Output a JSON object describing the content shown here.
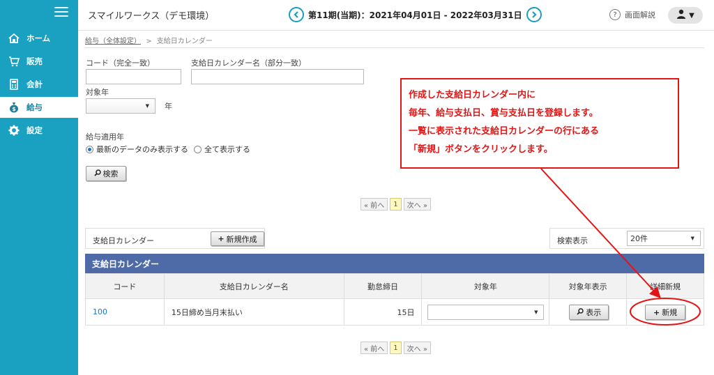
{
  "header": {
    "app_title": "スマイルワークス（デモ環境）",
    "period_text": "第11期(当期)：2021年04月01日 - 2022年03月31日",
    "prev_icon": "chevron-left-icon",
    "next_icon": "chevron-right-icon",
    "help_label": "画面解説",
    "user_icon": "user-icon"
  },
  "sidebar": {
    "items": [
      {
        "label": "ホーム",
        "icon": "home-icon"
      },
      {
        "label": "販売",
        "icon": "cart-icon"
      },
      {
        "label": "会計",
        "icon": "calculator-icon"
      },
      {
        "label": "給与",
        "icon": "money-bag-icon"
      },
      {
        "label": "設定",
        "icon": "gear-icon"
      }
    ],
    "active_index": 3
  },
  "breadcrumb": {
    "parent": "給与（全体設定）",
    "separator": ">",
    "current": "支給日カレンダー"
  },
  "search": {
    "code_label": "コード（完全一致）",
    "code_value": "",
    "name_label": "支給日カレンダー名（部分一致）",
    "name_value": "",
    "year_label": "対象年",
    "year_value": "",
    "year_suffix": "年",
    "apply_year_label": "給与適用年",
    "radio_latest": "最新のデータのみ表示する",
    "radio_all": "全て表示する",
    "radio_selected": "latest",
    "search_button": "検索"
  },
  "pager": {
    "prev": "« 前へ",
    "current": "1",
    "next": "次へ »"
  },
  "list": {
    "calendar_label": "支給日カレンダー",
    "new_button": "新規作成",
    "display_label": "検索表示",
    "display_value": "20件"
  },
  "table": {
    "title": "支給日カレンダー",
    "columns": [
      "コード",
      "支給日カレンダー名",
      "勤怠締日",
      "対象年",
      "対象年表示",
      "詳細新規"
    ],
    "rows": [
      {
        "code": "100",
        "name": "15日締め当月末払い",
        "close_day": "15日",
        "target_year": "",
        "show_button": "表示",
        "new_button": "新規"
      }
    ]
  },
  "callout": {
    "lines": [
      "作成した支給日カレンダー内に",
      "毎年、給与支払日、賞与支払日を登録します。",
      "一覧に表示された支給日カレンダーの行にある",
      "「新規」ボタンをクリックします。"
    ]
  },
  "colors": {
    "sidebar": "#1aa0c0",
    "table_header": "#4e6ba8",
    "callout": "#e41414",
    "link": "#1a73c8"
  }
}
